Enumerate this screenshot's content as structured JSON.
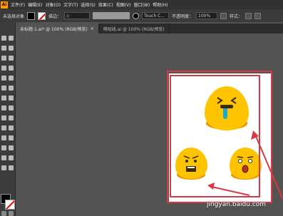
{
  "app": {
    "logo_text": "Ai"
  },
  "menu": [
    "文件(F)",
    "编辑(E)",
    "对象(O)",
    "文字(T)",
    "选择(S)",
    "效果(C)",
    "视图(V)",
    "窗口(W)",
    "帮助(H)"
  ],
  "control_bar": {
    "no_selection": "未选择对象",
    "stroke_label": "描边：",
    "stroke_value": "◇",
    "style_name": "Touch C...",
    "opacity_label": "不透明度：",
    "opacity_value": "100%",
    "style_label": "样式："
  },
  "tabs": [
    {
      "label": "未标题-1.ai* @ 100% (RGB/预览)",
      "close": "×"
    },
    {
      "label": "萌哒线.ai @ 100% (RGB/预览)",
      "close": ""
    }
  ],
  "watermark": "jingyan.baidu.com",
  "colors": {
    "accent_red": "#d63a44",
    "face_yellow": "#ffc400",
    "face_shadow": "#f09000"
  },
  "icons": [
    "selection-tool-icon",
    "direct-selection-icon",
    "pen-tool-icon",
    "type-tool-icon",
    "fill-swatch-icon",
    "stroke-none-icon"
  ]
}
